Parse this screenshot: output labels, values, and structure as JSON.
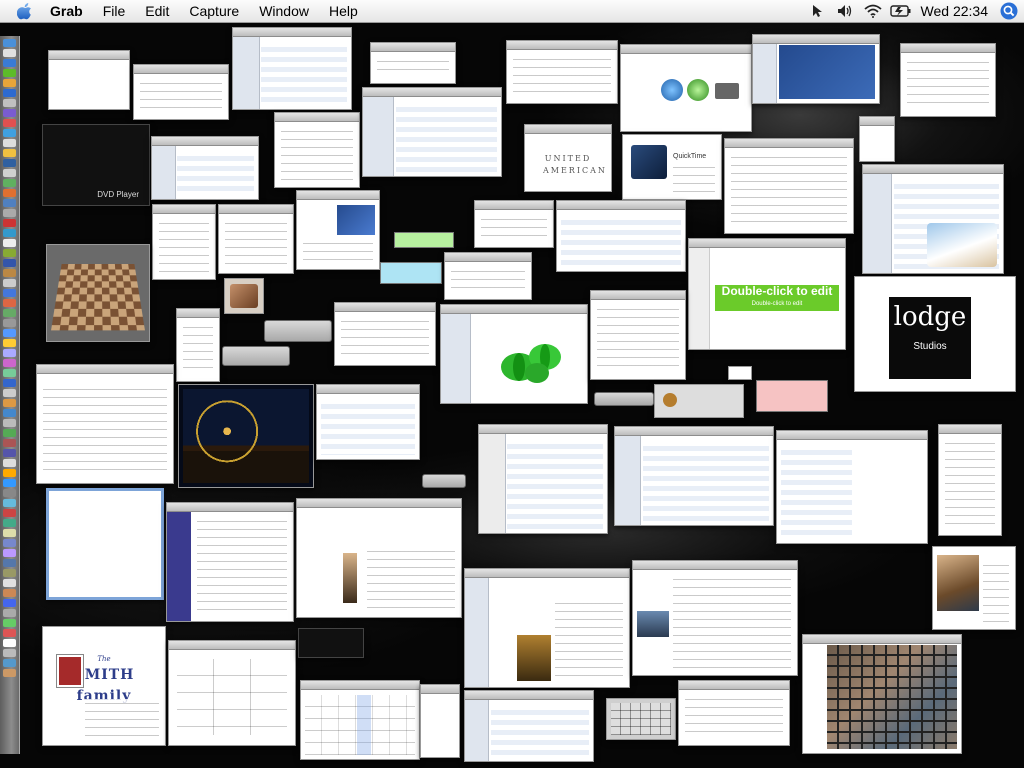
{
  "menubar": {
    "apple_icon": "apple-icon",
    "items": [
      {
        "label": "Grab",
        "app": true
      },
      {
        "label": "File"
      },
      {
        "label": "Edit"
      },
      {
        "label": "Capture"
      },
      {
        "label": "Window"
      },
      {
        "label": "Help"
      }
    ],
    "status_icons": [
      "pointer-icon",
      "volume-icon",
      "wifi-icon",
      "battery-icon"
    ],
    "clock": "Wed 22:34",
    "spotlight_icon": "spotlight-icon"
  },
  "dock": {
    "icon_colors": [
      "#4a90d9",
      "#e0e0e0",
      "#3a7bd5",
      "#5dbb2a",
      "#e8a53a",
      "#2d6ad0",
      "#c0c0c0",
      "#7a5cd0",
      "#e05050",
      "#40a0e0",
      "#ddd",
      "#f0c040",
      "#3060a0",
      "#d0d0d0",
      "#60b060",
      "#e07030",
      "#5080c0",
      "#aaaaaa",
      "#cc3333",
      "#3399cc",
      "#eeeeee",
      "#88aa33",
      "#3355aa",
      "#bb8844",
      "#cccccc",
      "#4477dd",
      "#dd6644",
      "#66aa66",
      "#999999",
      "#5599ff",
      "#ffcc33",
      "#aaaaff",
      "#cc66cc",
      "#77cc99",
      "#3366cc",
      "#cccccc",
      "#dd9944",
      "#4488cc",
      "#bbbbbb",
      "#55aa55",
      "#aa5555",
      "#5555aa",
      "#dddddd",
      "#ffaa00",
      "#3399ff",
      "#888888",
      "#66bbdd",
      "#cc4444",
      "#44aa88",
      "#ddddaa",
      "#7788cc",
      "#bb99ff",
      "#5577aa",
      "#999966",
      "#e0e0e0",
      "#cc8855",
      "#4466ee",
      "#aaaaaa",
      "#66cc66",
      "#dd5555",
      "#ffffff",
      "#bbbbbb",
      "#5599cc",
      "#cc9966"
    ]
  },
  "windows": {
    "lodge_text": "lodge",
    "lodge_sub": "Studios",
    "smith_pre": "The",
    "smith_family": "SMITH family",
    "double_click": "Double-click to edit",
    "americana": "UNITED AMERICAN",
    "quicktime_title": "QuickTime"
  }
}
